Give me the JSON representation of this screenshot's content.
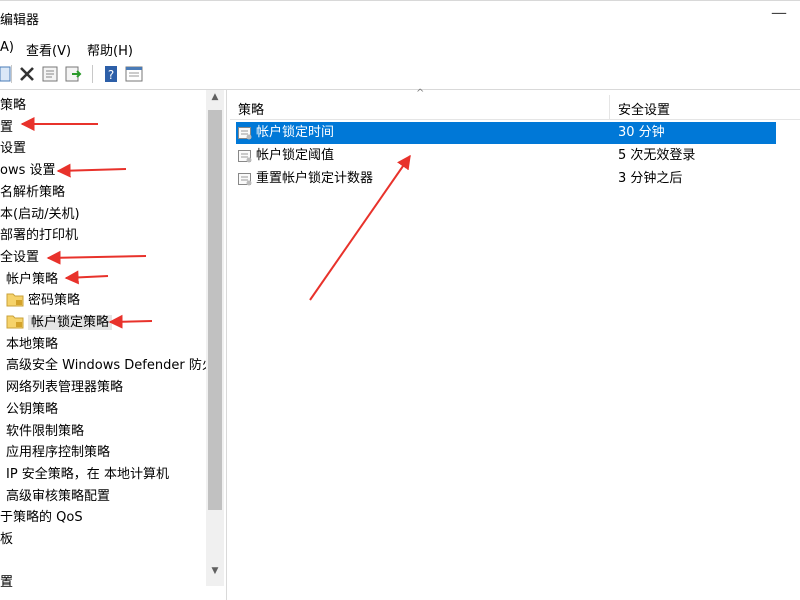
{
  "window": {
    "title": "编辑器",
    "minimize": "—"
  },
  "menu": [
    "A)",
    "查看(V)",
    "帮助(H)"
  ],
  "toolbar": {
    "icons": [
      "back-icon",
      "delete-icon",
      "properties-icon",
      "export-icon",
      "help-icon",
      "view-icon"
    ]
  },
  "tree": {
    "items": [
      {
        "label": "策略",
        "folder": false
      },
      {
        "label": "置",
        "folder": false
      },
      {
        "label": "设置",
        "folder": false
      },
      {
        "label": "ows 设置",
        "folder": false
      },
      {
        "label": "名解析策略",
        "folder": false
      },
      {
        "label": "本(启动/关机)",
        "folder": false
      },
      {
        "label": "部署的打印机",
        "folder": false
      },
      {
        "label": "全设置",
        "folder": false
      },
      {
        "label": "帐户策略",
        "folder": false
      },
      {
        "label": "密码策略",
        "folder": true
      },
      {
        "label": "帐户锁定策略",
        "folder": true,
        "selected": true
      },
      {
        "label": "本地策略",
        "folder": false
      },
      {
        "label": "高级安全 Windows Defender 防火",
        "folder": false
      },
      {
        "label": "网络列表管理器策略",
        "folder": false
      },
      {
        "label": "公钥策略",
        "folder": false
      },
      {
        "label": "软件限制策略",
        "folder": false
      },
      {
        "label": "应用程序控制策略",
        "folder": false
      },
      {
        "label": "IP 安全策略，在 本地计算机",
        "folder": false
      },
      {
        "label": "高级审核策略配置",
        "folder": false
      },
      {
        "label": "于策略的 QoS",
        "folder": false
      },
      {
        "label": "板",
        "folder": false
      },
      {
        "label": "",
        "folder": false
      },
      {
        "label": "置",
        "folder": false
      }
    ]
  },
  "list": {
    "columns": [
      "策略",
      "安全设置"
    ],
    "rows": [
      {
        "policy": "帐户锁定时间",
        "setting": "30 分钟",
        "selected": true
      },
      {
        "policy": "帐户锁定阈值",
        "setting": "5 次无效登录"
      },
      {
        "policy": "重置帐户锁定计数器",
        "setting": "3 分钟之后"
      }
    ]
  },
  "colors": {
    "selection": "#0078d7",
    "annotation": "#e8322b"
  }
}
